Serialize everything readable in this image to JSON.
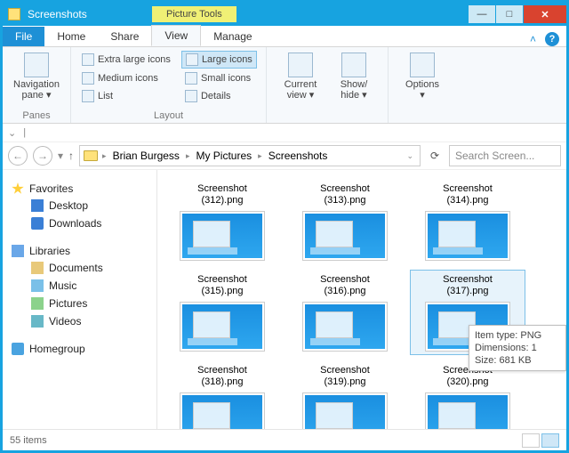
{
  "title": "Screenshots",
  "context_tab": "Picture Tools",
  "tabs": {
    "file": "File",
    "home": "Home",
    "share": "Share",
    "view": "View",
    "manage": "Manage"
  },
  "ribbon": {
    "panes": {
      "nav_pane": "Navigation\npane",
      "label": "Panes"
    },
    "layout": {
      "extra_large": "Extra large icons",
      "large": "Large icons",
      "medium": "Medium icons",
      "small": "Small icons",
      "list": "List",
      "details": "Details",
      "label": "Layout"
    },
    "currentview": {
      "current": "Current\nview",
      "showhide": "Show/\nhide"
    },
    "options": "Options"
  },
  "breadcrumbs": [
    "Brian Burgess",
    "My Pictures",
    "Screenshots"
  ],
  "search_placeholder": "Search Screen...",
  "nav": {
    "favorites": "Favorites",
    "desktop": "Desktop",
    "downloads": "Downloads",
    "libraries": "Libraries",
    "documents": "Documents",
    "music": "Music",
    "pictures": "Pictures",
    "videos": "Videos",
    "homegroup": "Homegroup"
  },
  "files": [
    {
      "name": "Screenshot (312).png"
    },
    {
      "name": "Screenshot (313).png"
    },
    {
      "name": "Screenshot (314).png"
    },
    {
      "name": "Screenshot (315).png"
    },
    {
      "name": "Screenshot (316).png"
    },
    {
      "name": "Screenshot (317).png",
      "selected": true
    },
    {
      "name": "Screenshot (318).png"
    },
    {
      "name": "Screenshot (319).png"
    },
    {
      "name": "Screenshot (320).png"
    }
  ],
  "tooltip": {
    "line1": "Item type: PNG",
    "line2": "Dimensions: 1",
    "line3": "Size: 681 KB"
  },
  "status": "55 items"
}
